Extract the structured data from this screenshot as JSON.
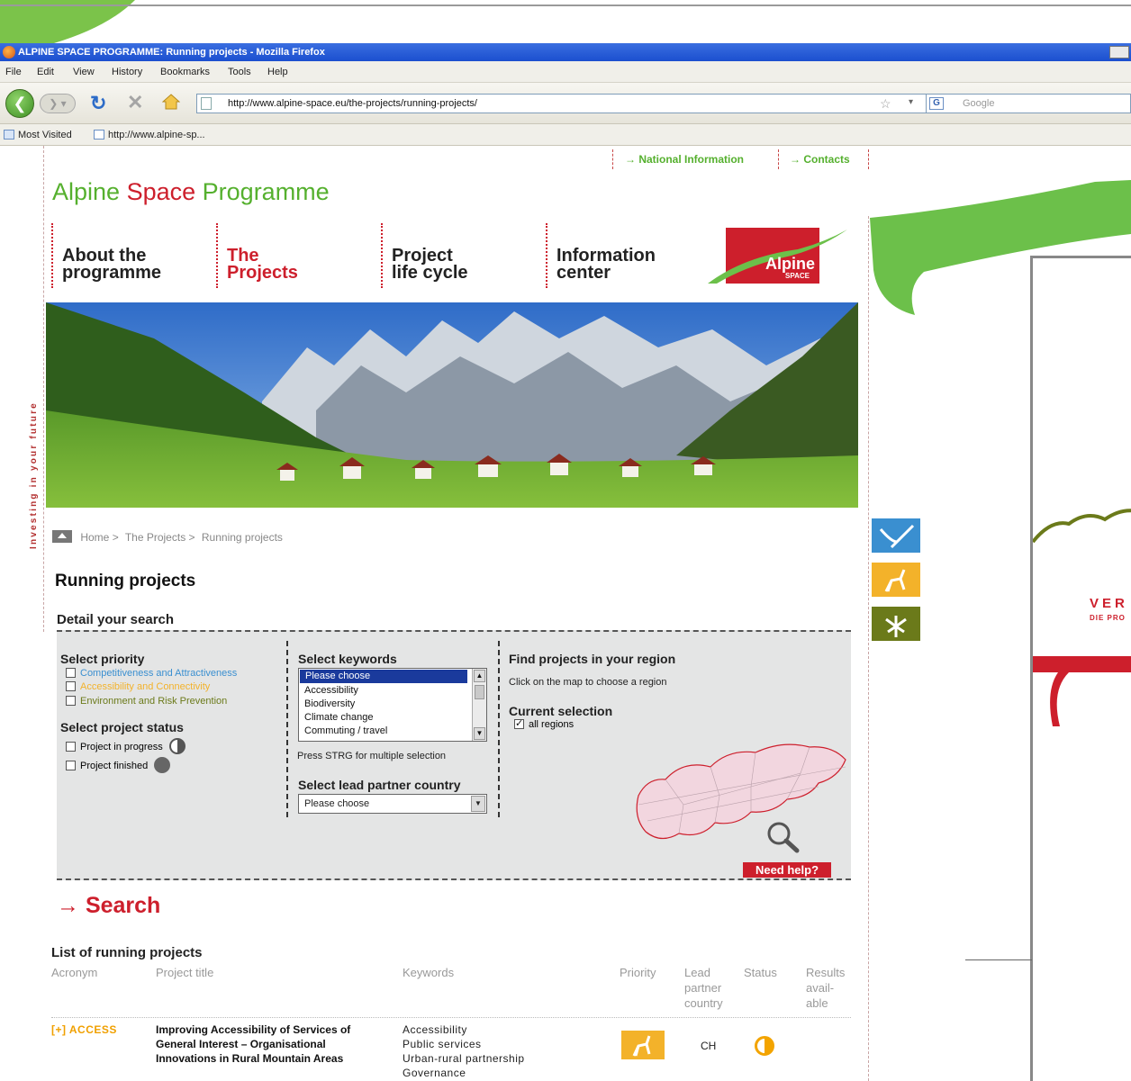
{
  "browser": {
    "window_title": "ALPINE SPACE PROGRAMME: Running projects - Mozilla Firefox",
    "menu": [
      "File",
      "Edit",
      "View",
      "History",
      "Bookmarks",
      "Tools",
      "Help"
    ],
    "url": "http://www.alpine-space.eu/the-projects/running-projects/",
    "search_placeholder": "Google",
    "bookmarks": [
      "Most Visited",
      "http://www.alpine-sp..."
    ]
  },
  "site": {
    "top_links": [
      "→ National Information",
      "→ Contacts"
    ],
    "brand": {
      "part1": "Alpine",
      "part2": "Space",
      "part3": "Programme"
    },
    "vertical_tag": "Investing in your future",
    "nav": [
      {
        "line1": "About the",
        "line2": "programme"
      },
      {
        "line1": "The",
        "line2": "Projects"
      },
      {
        "line1": "Project",
        "line2": "life cycle"
      },
      {
        "line1": "Information",
        "line2": "center"
      }
    ],
    "logo_text": "Alpine",
    "logo_sub": "SPACE"
  },
  "breadcrumb": [
    "Home >",
    "The Projects >",
    "Running projects"
  ],
  "page_title": "Running projects",
  "search": {
    "detail_title": "Detail your search",
    "priority": {
      "heading": "Select priority",
      "items": [
        {
          "label": "Competitiveness and Attractiveness",
          "color": "#3a8fd0"
        },
        {
          "label": "Accessibility and Connectivity",
          "color": "#f3b22a"
        },
        {
          "label": "Environment and Risk Prevention",
          "color": "#6b7a1a"
        }
      ]
    },
    "status": {
      "heading": "Select project status",
      "items": [
        "Project in progress",
        "Project finished"
      ]
    },
    "keywords": {
      "heading": "Select keywords",
      "options": [
        "Please choose",
        "Accessibility",
        "Biodiversity",
        "Climate change",
        "Commuting / travel"
      ],
      "hint": "Press STRG for multiple selection"
    },
    "lead_country": {
      "heading": "Select lead partner country",
      "value": "Please choose"
    },
    "region": {
      "heading": "Find projects in your region",
      "hint": "Click on the map to choose a region",
      "current_heading": "Current selection",
      "current_value": "all regions"
    },
    "help_label": "Need help?",
    "search_label": "→ Search"
  },
  "list": {
    "title": "List of running projects",
    "headers": [
      "Acronym",
      "Project title",
      "Keywords",
      "Priority",
      "Lead partner country",
      "Status",
      "Results avail-able"
    ],
    "rows": [
      {
        "acronym": "[+] ACCESS",
        "title": "Improving Accessibility of Services of General Interest – Organisational Innovations in Rural Mountain Areas",
        "keywords": [
          "Accessibility",
          "Public services",
          "Urban-rural partnership",
          "Governance"
        ],
        "priority_icon": "deer-icon",
        "country": "CH",
        "status_icon": "half-circle-icon"
      }
    ]
  },
  "right_panel": {
    "ver_text": "VER",
    "sub_text": "DIE PRO"
  }
}
